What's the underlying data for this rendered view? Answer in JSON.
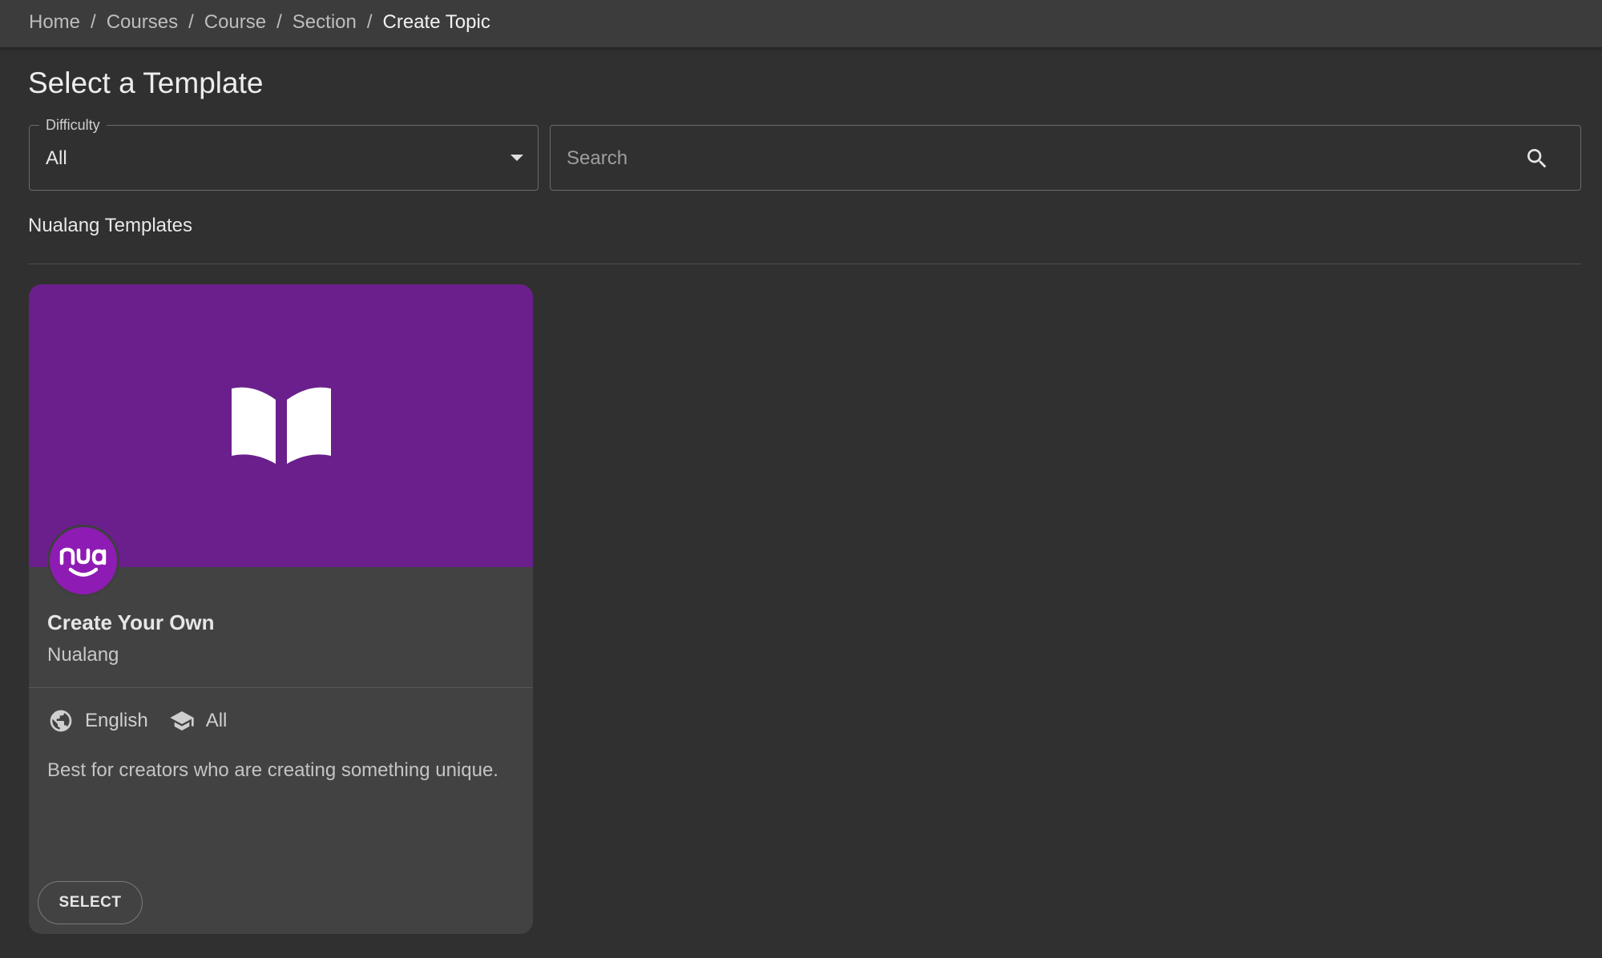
{
  "breadcrumb": {
    "items": [
      "Home",
      "Courses",
      "Course",
      "Section"
    ],
    "current": "Create Topic",
    "separator": "/"
  },
  "page": {
    "title": "Select a Template"
  },
  "filters": {
    "difficulty": {
      "label": "Difficulty",
      "value": "All"
    },
    "search": {
      "placeholder": "Search",
      "value": ""
    }
  },
  "section": {
    "heading": "Nualang Templates"
  },
  "card": {
    "title": "Create Your Own",
    "author": "Nualang",
    "language": "English",
    "difficulty": "All",
    "description": "Best for creators who are creating something unique.",
    "select_label": "SELECT",
    "banner_icon": "book-open-icon",
    "avatar_logo": "nualang-logo"
  },
  "colors": {
    "background": "#303030",
    "topbar": "#3c3c3c",
    "card": "#424242",
    "banner": "#6a1f8c",
    "avatar": "#8e1bb3"
  }
}
